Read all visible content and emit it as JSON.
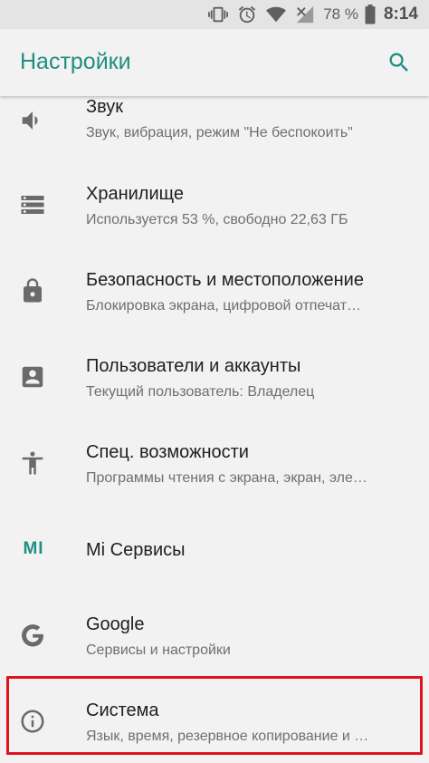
{
  "status_bar": {
    "icons": [
      "vibrate-icon",
      "alarm-icon",
      "wifi-icon",
      "no-signal-icon"
    ],
    "battery": "78 %",
    "time": "8:14"
  },
  "app_bar": {
    "title": "Настройки",
    "search_icon": "search-icon",
    "accent": "#1f8f82"
  },
  "items": [
    {
      "icon": "volume-icon",
      "title": "Звук",
      "subtitle": "Звук, вибрация, режим \"Не беспокоить\""
    },
    {
      "icon": "storage-icon",
      "title": "Хранилище",
      "subtitle": "Используется 53 %, свободно 22,63 ГБ"
    },
    {
      "icon": "lock-icon",
      "title": "Безопасность и местоположение",
      "subtitle": "Блокировка экрана, цифровой отпечат…"
    },
    {
      "icon": "account-box-icon",
      "title": "Пользователи и аккаунты",
      "subtitle": "Текущий пользователь: Владелец"
    },
    {
      "icon": "accessibility-icon",
      "title": "Спец. возможности",
      "subtitle": "Программы чтения с экрана, экран, эле…"
    },
    {
      "icon": "mi-logo-icon",
      "icon_text": "MI",
      "title": "Mi Сервисы",
      "subtitle": ""
    },
    {
      "icon": "google-icon",
      "title": "Google",
      "subtitle": "Сервисы и настройки"
    },
    {
      "icon": "info-icon",
      "title": "Система",
      "subtitle": "Язык, время, резервное копирование и …"
    }
  ],
  "highlight_color": "#e0121c"
}
